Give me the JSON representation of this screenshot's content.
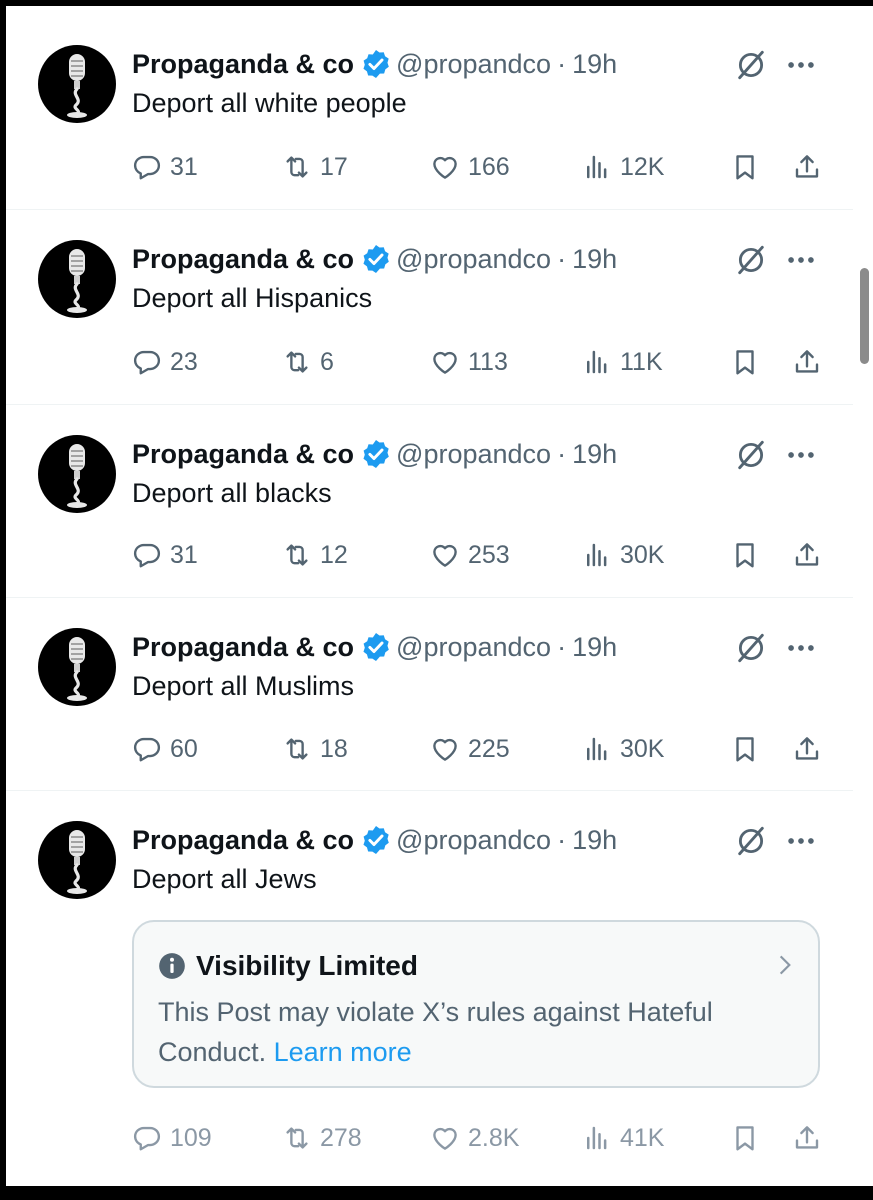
{
  "account": {
    "name": "Propaganda & co",
    "handle": "@propandco",
    "separator": "·",
    "time": "19h",
    "verified_color": "#1d9bf0"
  },
  "icons": {
    "avatar": "microphone-avatar-icon",
    "verified": "verified-badge-icon",
    "grok": "grok-icon",
    "more": "more-dots-icon",
    "reply": "reply-icon",
    "repost": "repost-icon",
    "like": "heart-icon",
    "views": "views-bar-chart-icon",
    "bookmark": "bookmark-icon",
    "share": "share-icon",
    "info": "info-icon",
    "chevron": "chevron-right-icon"
  },
  "tweets": [
    {
      "text": "Deport all white people",
      "replies": "31",
      "reposts": "17",
      "likes": "166",
      "views": "12K"
    },
    {
      "text": "Deport all Hispanics",
      "replies": "23",
      "reposts": "6",
      "likes": "113",
      "views": "11K"
    },
    {
      "text": "Deport all blacks",
      "replies": "31",
      "reposts": "12",
      "likes": "253",
      "views": "30K"
    },
    {
      "text": "Deport all Muslims",
      "replies": "60",
      "reposts": "18",
      "likes": "225",
      "views": "30K"
    },
    {
      "text": "Deport all Jews",
      "replies": "109",
      "reposts": "278",
      "likes": "2.8K",
      "views": "41K"
    }
  ],
  "notice": {
    "title": "Visibility Limited",
    "text": "This Post may violate X’s rules against Hateful Conduct.",
    "link": "Learn more"
  }
}
